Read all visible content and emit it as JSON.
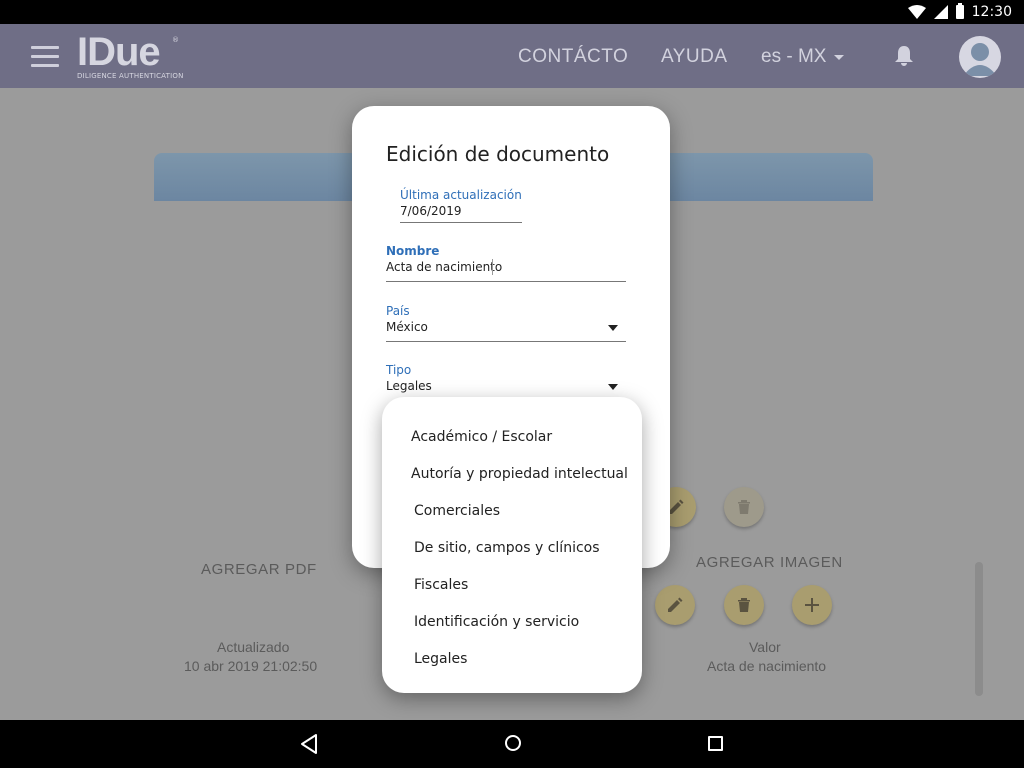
{
  "status_bar": {
    "time": "12:30"
  },
  "app_bar": {
    "logo_text": "IDue",
    "logo_registered": "®",
    "logo_subtitle": "DILIGENCE AUTHENTICATION",
    "nav_contact": "CONTÁCTO",
    "nav_help": "AYUDA",
    "language": "es - MX"
  },
  "page": {
    "add_pdf": "AGREGAR PDF",
    "add_image": "AGREGAR IMAGEN",
    "updated_label": "Actualizado",
    "updated_value": "10 abr 2019 21:02:50",
    "value_label": "Valor",
    "value_value": "Acta de nacimiento"
  },
  "dialog": {
    "title": "Edición de documento",
    "last_update_label": "Última actualización",
    "last_update_value": "7/06/2019",
    "name_label": "Nombre",
    "name_value": "Acta de nacimiento",
    "country_label": "País",
    "country_value": "México",
    "type_label": "Tipo",
    "type_value": "Legales"
  },
  "dropdown": {
    "options": [
      "Académico / Escolar",
      "Autoría y propiedad intelectual",
      "Comerciales",
      "De sitio, campos y clínicos",
      "Fiscales",
      "Identificación y servicio",
      "Legales"
    ]
  },
  "colors": {
    "app_bar": "#6f6e86",
    "accent_label": "#2f6fb8",
    "fab": "#a99d6f",
    "overlay_bg": "#9b9b9b"
  }
}
